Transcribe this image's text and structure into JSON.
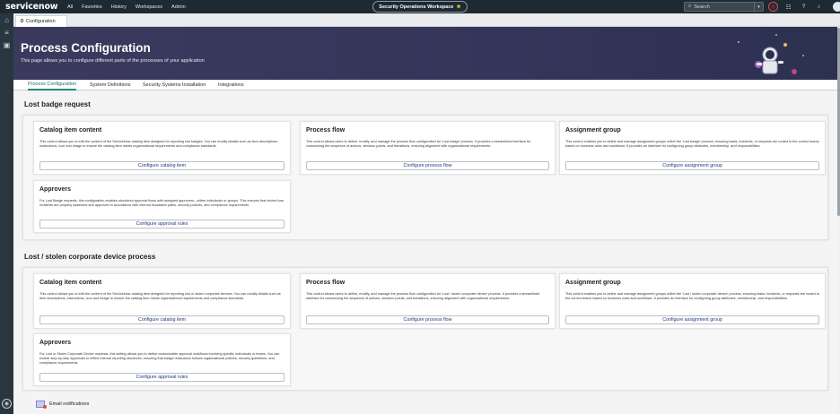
{
  "topnav": {
    "logo_text": "servicenow",
    "links": [
      "All",
      "Favorites",
      "History",
      "Workspaces",
      "Admin"
    ],
    "workspace_label": "Security Operations Workspace",
    "search_placeholder": "Search",
    "icons": [
      "globe-icon",
      "chat-icon",
      "help-icon",
      "bell-icon",
      "avatar"
    ]
  },
  "tabstrip": {
    "tab_label": "Configuration"
  },
  "hero": {
    "title": "Process Configuration",
    "subtitle": "This page allows you to configure different parts of the processes of your application"
  },
  "subtabs": [
    "Process Configuration",
    "System Definitions",
    "Security Systems Installation",
    "Integrations"
  ],
  "sections": [
    {
      "title": "Lost badge request",
      "cards": [
        {
          "title": "Catalog item content",
          "description": "This control allows you to edit the content of the ServiceNow catalog item designed for reporting lost badges. You can modify details such as item descriptions, instructions, icon and image to ensure the catalog item meets organizational requirements and compliance standards.",
          "button": "Configure catalog item"
        },
        {
          "title": "Process flow",
          "description": "This control allows users to define, modify, and manage the process flow configuration for 'Lost badge' process. It provides a streamlined interface for customizing the sequence of actions, decision points, and transitions, ensuring alignment with organizational requirements.",
          "button": "Configure process flow"
        },
        {
          "title": "Assignment group",
          "description": "This control enables you to define and manage assignment groups within the 'Lost badge' process, ensuring tasks, incidents, or requests are routed to the correct teams based on business rules and workflows. It provides an interface for configuring group attributes, membership, and responsibilities.",
          "button": "Configure assignment group"
        },
        {
          "title": "Approvers",
          "description": "For Lost Badge requests, this configuration enables structured approval flows with assigned approvers—either individuals or groups. This ensures that device loss incidents are properly assessed and approved in accordance with internal escalation paths, security policies, and compliance requirements.",
          "button": "Configure approval rules"
        }
      ]
    },
    {
      "title": "Lost / stolen corporate device process",
      "cards": [
        {
          "title": "Catalog item content",
          "description": "This control allows you to edit the content of the ServiceNow catalog item designed for reporting lost or stolen corporate devices. You can modify details such as item descriptions, instructions, icon and image to ensure the catalog item meets organizational requirements and compliance standards.",
          "button": "Configure catalog item"
        },
        {
          "title": "Process flow",
          "description": "This control allows users to define, modify, and manage the process flow configuration for 'Lost / stolen corporate device' process. It provides a streamlined interface for customizing the sequence of actions, decision points, and transitions, ensuring alignment with organizational requirements.",
          "button": "Configure process flow"
        },
        {
          "title": "Assignment group",
          "description": "This control enables you to define and manage assignment groups within the 'Lost / stolen corporate device' process, ensuring tasks, incidents, or requests are routed to the correct teams based on business rules and workflows. It provides an interface for configuring group attributes, membership, and responsibilities.",
          "button": "Configure assignment group"
        },
        {
          "title": "Approvers",
          "description": "For Lost or Stolen Corporate Device requests, this setting allows you to define customizable approval workflows involving specific individuals or teams. You can enable step-by-step approvals to reflect internal reporting structures, ensuring that badge reissuance follows organizational policies, security guidelines, and compliance requirements.",
          "button": "Configure approval rules"
        }
      ]
    }
  ],
  "email_notifications": "Email notifications",
  "colors": {
    "nav_bg": "#1e2a33",
    "hero_bg": "#3b3a5e",
    "accent": "#1f8a78",
    "link": "#23357f"
  }
}
